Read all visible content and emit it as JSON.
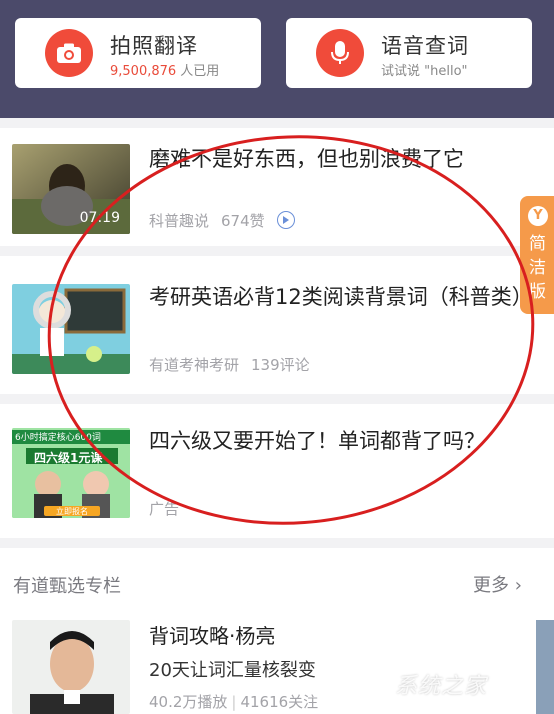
{
  "tools": {
    "photo_translate": {
      "title": "拍照翻译",
      "count": "9,500,876",
      "suffix": " 人已用"
    },
    "voice_lookup": {
      "title": "语音查词",
      "subtitle": "试试说 \"hello\""
    }
  },
  "feed": [
    {
      "title": "磨难不是好东西，但也别浪费了它",
      "duration": "07:19",
      "source": "科普趣说",
      "stats": "674赞"
    },
    {
      "title": "考研英语必背12类阅读背景词（科普类）",
      "source": "有道考神考研",
      "stats": "139评论"
    },
    {
      "title": "四六级又要开始了！单词都背了吗？",
      "source": "广告",
      "ad_banner_top": "6小时搞定核心600词",
      "ad_banner_main": "四六级1元课",
      "ad_banner_cta": "立即报名"
    }
  ],
  "side_tab": {
    "icon": "Y",
    "label": "简洁版"
  },
  "section": {
    "title": "有道甄选专栏",
    "more": "更多"
  },
  "course": {
    "name": "背词攻略·杨亮",
    "desc": "20天让词汇量核裂变",
    "plays": "40.2万播放",
    "follows": "41616关注"
  },
  "watermark": "系统之家",
  "colors": {
    "header": "#4b4a6a",
    "accent_red": "#f04b3a",
    "side_tab": "#f59a4a",
    "ring": "#d81f1f"
  }
}
